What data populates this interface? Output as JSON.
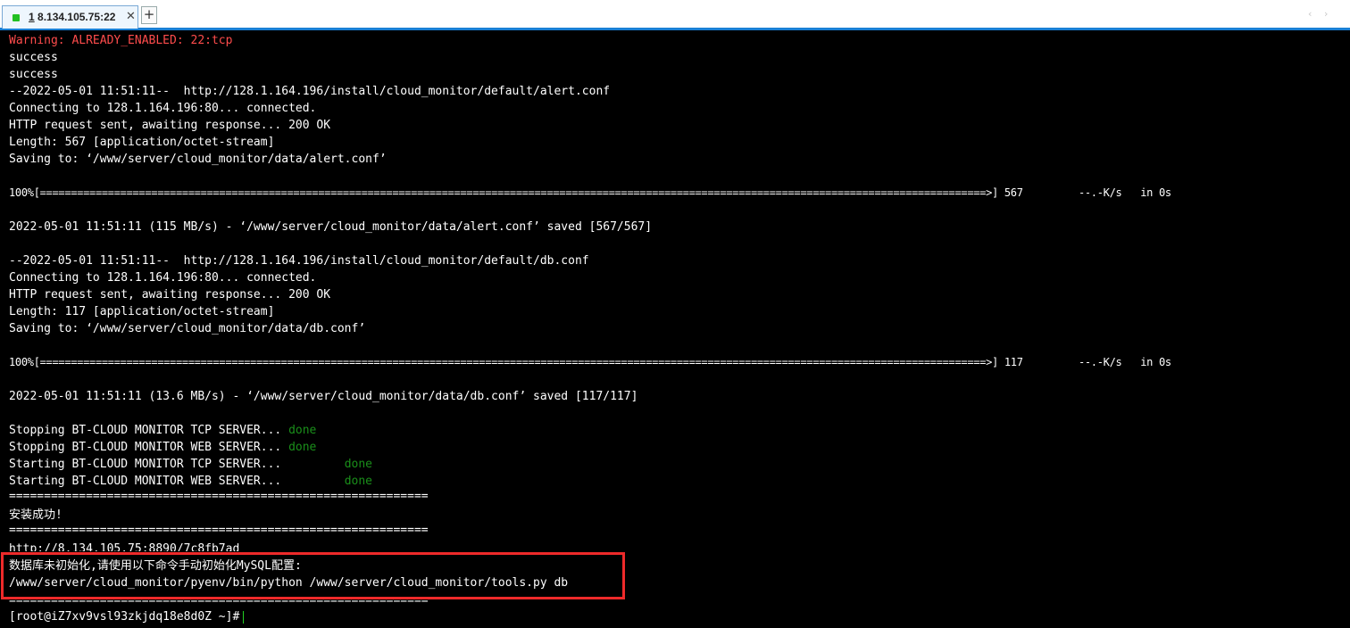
{
  "tabbar": {
    "tab_number": "1",
    "tab_host": "8.134.105.75:22",
    "close_glyph": "✕",
    "new_tab_glyph": "+",
    "scroll_left_glyph": "‹",
    "scroll_right_glyph": "›"
  },
  "terminal": {
    "warning": "Warning: ALREADY_ENABLED: 22:tcp",
    "success1": "success",
    "success2": "success",
    "dl1_url": "--2022-05-01 11:51:11--  http://128.1.164.196/install/cloud_monitor/default/alert.conf",
    "dl1_connect": "Connecting to 128.1.164.196:80... connected.",
    "dl1_http": "HTTP request sent, awaiting response... 200 OK",
    "dl1_length": "Length: 567 [application/octet-stream]",
    "dl1_saving": "Saving to: ‘/www/server/cloud_monitor/data/alert.conf’",
    "dl1_progress": "100%[=========================================================================================================================================================>] 567         --.-K/s   in 0s",
    "dl1_saved": "2022-05-01 11:51:11 (115 MB/s) - ‘/www/server/cloud_monitor/data/alert.conf’ saved [567/567]",
    "dl2_url": "--2022-05-01 11:51:11--  http://128.1.164.196/install/cloud_monitor/default/db.conf",
    "dl2_connect": "Connecting to 128.1.164.196:80... connected.",
    "dl2_http": "HTTP request sent, awaiting response... 200 OK",
    "dl2_length": "Length: 117 [application/octet-stream]",
    "dl2_saving": "Saving to: ‘/www/server/cloud_monitor/data/db.conf’",
    "dl2_progress": "100%[=========================================================================================================================================================>] 117         --.-K/s   in 0s",
    "dl2_saved": "2022-05-01 11:51:11 (13.6 MB/s) - ‘/www/server/cloud_monitor/data/db.conf’ saved [117/117]",
    "stop_tcp": "Stopping BT-CLOUD MONITOR TCP SERVER... ",
    "stop_web": "Stopping BT-CLOUD MONITOR WEB SERVER... ",
    "start_tcp": "Starting BT-CLOUD MONITOR TCP SERVER...         ",
    "start_web": "Starting BT-CLOUD MONITOR WEB SERVER...         ",
    "done": "done",
    "separator": "============================================================",
    "install_success": "安装成功!",
    "url_line": "http://8.134.105.75:8890/7c8fb7ad",
    "db_notice": "数据库未初始化,请使用以下命令手动初始化MySQL配置:",
    "db_command": "/www/server/cloud_monitor/pyenv/bin/python /www/server/cloud_monitor/tools.py db",
    "prompt": "[root@iZ7xv9vsl93zkjdq18e8d0Z ~]#"
  },
  "colors": {
    "warning": "#ff4c4c",
    "done": "#1a8f1a",
    "highlight_border": "#ee2a2a",
    "tab_active_accent": "#1a7fd4",
    "status_dot": "#22c022"
  }
}
